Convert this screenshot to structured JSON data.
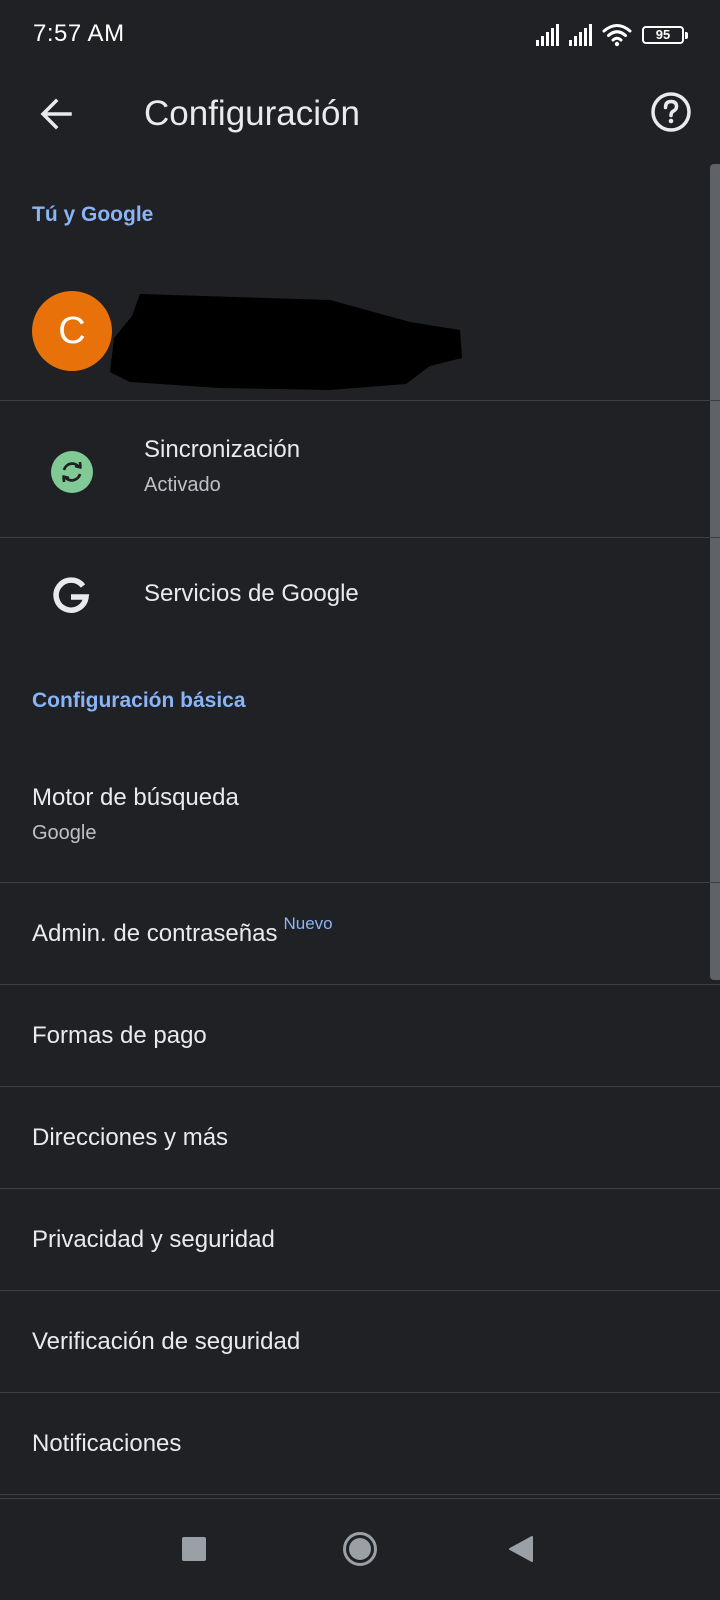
{
  "status_bar": {
    "time": "7:57 AM",
    "battery": "95",
    "icons": [
      "signal-icon",
      "signal-icon",
      "wifi-icon",
      "battery-icon"
    ]
  },
  "app_bar": {
    "title": "Configuración",
    "back_icon": "arrow-back-icon",
    "help_icon": "help-icon"
  },
  "sections": {
    "you_and_google": {
      "header": "Tú y Google",
      "account_initial": "C",
      "avatar_color": "#e8710a",
      "sync": {
        "title": "Sincronización",
        "subtitle": "Activado",
        "icon": "sync-icon",
        "icon_color": "#81c995"
      },
      "google_services": {
        "title": "Servicios de Google",
        "icon": "google-g-icon"
      }
    },
    "basic": {
      "header": "Configuración básica",
      "search_engine": {
        "title": "Motor de búsqueda",
        "subtitle": "Google"
      },
      "password_manager": {
        "title": "Admin. de contraseñas",
        "badge": "Nuevo"
      },
      "items": [
        "Formas de pago",
        "Direcciones y más",
        "Privacidad y seguridad",
        "Verificación de seguridad",
        "Notificaciones"
      ]
    }
  },
  "colors": {
    "background": "#202124",
    "accent": "#8ab4f8",
    "text_primary": "#e8eaed",
    "text_secondary": "#bdc1c6"
  },
  "nav_bar": {
    "buttons": [
      "recents-square-icon",
      "home-circle-icon",
      "back-triangle-icon"
    ]
  }
}
